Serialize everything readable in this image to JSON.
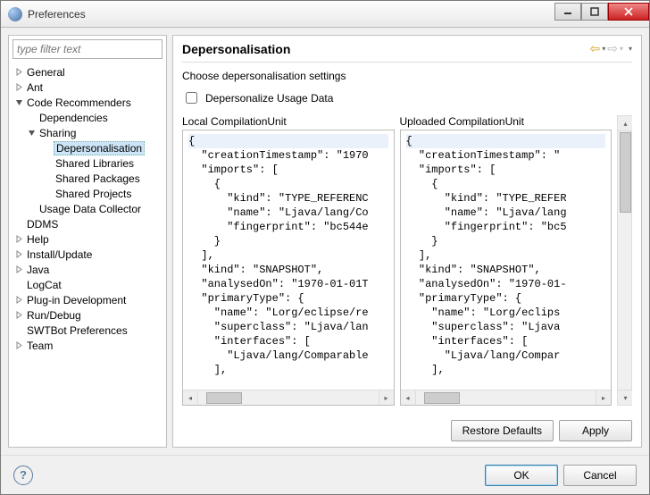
{
  "window": {
    "title": "Preferences"
  },
  "filter": {
    "placeholder": "type filter text"
  },
  "tree": {
    "items": [
      {
        "label": "General",
        "arrow": "closed",
        "indent": 0
      },
      {
        "label": "Ant",
        "arrow": "closed",
        "indent": 0
      },
      {
        "label": "Code Recommenders",
        "arrow": "open",
        "indent": 0
      },
      {
        "label": "Dependencies",
        "arrow": "none",
        "indent": 1
      },
      {
        "label": "Sharing",
        "arrow": "open",
        "indent": 1
      },
      {
        "label": "Depersonalisation",
        "arrow": "none",
        "indent": 2,
        "selected": true
      },
      {
        "label": "Shared Libraries",
        "arrow": "none",
        "indent": 2
      },
      {
        "label": "Shared Packages",
        "arrow": "none",
        "indent": 2
      },
      {
        "label": "Shared Projects",
        "arrow": "none",
        "indent": 2
      },
      {
        "label": "Usage Data Collector",
        "arrow": "none",
        "indent": 1
      },
      {
        "label": "DDMS",
        "arrow": "none",
        "indent": 0
      },
      {
        "label": "Help",
        "arrow": "closed",
        "indent": 0
      },
      {
        "label": "Install/Update",
        "arrow": "closed",
        "indent": 0
      },
      {
        "label": "Java",
        "arrow": "closed",
        "indent": 0
      },
      {
        "label": "LogCat",
        "arrow": "none",
        "indent": 0
      },
      {
        "label": "Plug-in Development",
        "arrow": "closed",
        "indent": 0
      },
      {
        "label": "Run/Debug",
        "arrow": "closed",
        "indent": 0
      },
      {
        "label": "SWTBot Preferences",
        "arrow": "none",
        "indent": 0
      },
      {
        "label": "Team",
        "arrow": "closed",
        "indent": 0
      }
    ]
  },
  "page": {
    "title": "Depersonalisation",
    "description": "Choose depersonalisation settings",
    "checkbox_label": "Depersonalize Usage Data",
    "local_label": "Local CompilationUnit",
    "uploaded_label": "Uploaded CompilationUnit",
    "restore_defaults": "Restore Defaults",
    "apply": "Apply"
  },
  "code": {
    "local": "{\n  \"creationTimestamp\": \"1970\n  \"imports\": [\n    {\n      \"kind\": \"TYPE_REFERENC\n      \"name\": \"Ljava/lang/Co\n      \"fingerprint\": \"bc544e\n    }\n  ],\n  \"kind\": \"SNAPSHOT\",\n  \"analysedOn\": \"1970-01-01T\n  \"primaryType\": {\n    \"name\": \"Lorg/eclipse/re\n    \"superclass\": \"Ljava/lan\n    \"interfaces\": [\n      \"Ljava/lang/Comparable\n    ],",
    "uploaded": "{\n  \"creationTimestamp\": \"\n  \"imports\": [\n    {\n      \"kind\": \"TYPE_REFER\n      \"name\": \"Ljava/lang\n      \"fingerprint\": \"bc5\n    }\n  ],\n  \"kind\": \"SNAPSHOT\",\n  \"analysedOn\": \"1970-01-\n  \"primaryType\": {\n    \"name\": \"Lorg/eclips\n    \"superclass\": \"Ljava\n    \"interfaces\": [\n      \"Ljava/lang/Compar\n    ],"
  },
  "footer": {
    "ok": "OK",
    "cancel": "Cancel"
  }
}
